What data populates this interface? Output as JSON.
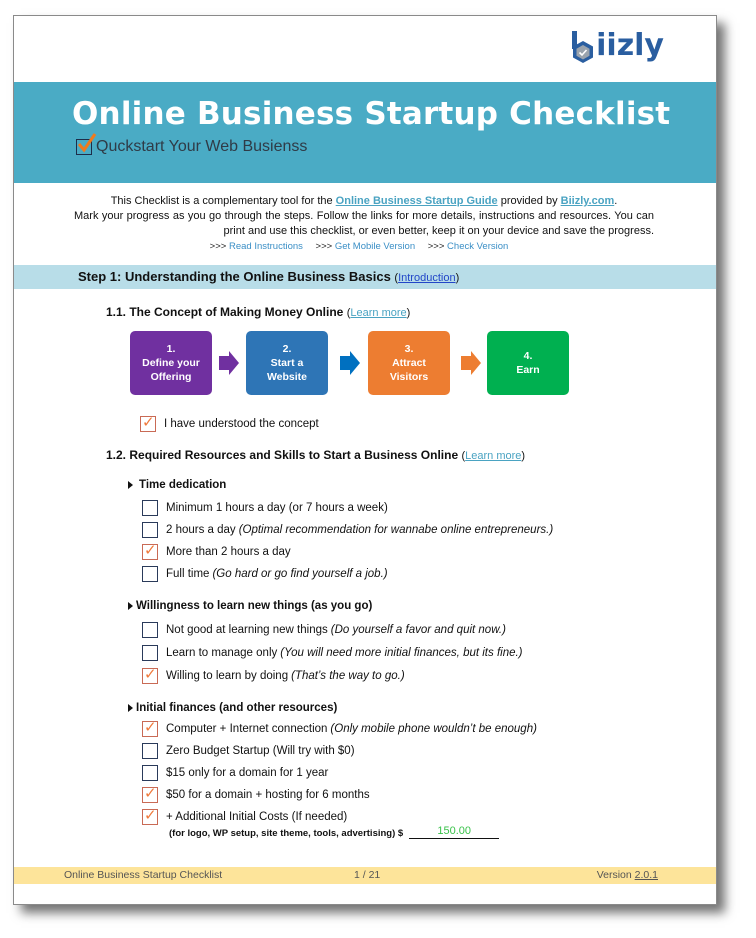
{
  "brand": {
    "logo_text": "iizly",
    "logo_color": "#2a5ea0",
    "banner_color": "#4aabc5"
  },
  "header": {
    "title": "Online Business Startup Checklist",
    "subtitle": "Quckstart Your Web Busienss"
  },
  "intro": {
    "line1_pre": "This Checklist is a complementary tool for the ",
    "guide_link": "Online Business Startup Guide",
    "line1_mid": " provided by ",
    "site_link": "Biizly.com",
    "line1_post": ".",
    "line2": "Mark your progress as you go through the steps. Follow the links for more details, instructions and resources. You can print and use this checklist, or even better, keep it on your device and save the progress.",
    "links": [
      {
        "prefix": ">>> ",
        "label": "Read Instructions"
      },
      {
        "prefix": ">>> ",
        "label": "Get Mobile Version"
      },
      {
        "prefix": ">>> ",
        "label": "Check Version"
      }
    ]
  },
  "step1": {
    "title": "Step 1: Understanding the Online Business Basics ",
    "link": "Introduction",
    "s11": {
      "title": "1.1. The Concept of Making Money Online ",
      "link": "Learn more",
      "flow": [
        {
          "num": "1.",
          "label": "Define your Offering",
          "color": "#7030a0"
        },
        {
          "num": "2.",
          "label": "Start a Website",
          "color": "#2e75b6"
        },
        {
          "num": "3.",
          "label": "Attract Visitors",
          "color": "#ed7d31"
        },
        {
          "num": "4.",
          "label": "Earn",
          "color": "#00b050"
        }
      ],
      "arrow_colors": [
        "#7030a0",
        "#0070c0",
        "#ed7d31"
      ],
      "check": {
        "label": "I have understood the concept",
        "checked": true
      }
    },
    "s12": {
      "title": "1.2. Required Resources and Skills to Start a Business Online ",
      "link": "Learn more",
      "groups": [
        {
          "label": "Time dedication",
          "items": [
            {
              "label": "Minimum 1 hours a day (or 7 hours a week)",
              "note": "",
              "checked": false
            },
            {
              "label": "2 hours a day",
              "note": "(Optimal recommendation for wannabe online entrepreneurs.)",
              "checked": false
            },
            {
              "label": "More than 2 hours a day",
              "note": "",
              "checked": true
            },
            {
              "label": "Full time",
              "note": "(Go hard or go find yourself a job.)",
              "checked": false
            }
          ]
        },
        {
          "label": "Willingness to learn new things (as you go)",
          "items": [
            {
              "label": "Not good at learning new things",
              "note": "(Do yourself a favor and quit now.)",
              "checked": false
            },
            {
              "label": "Learn to manage only",
              "note": "(You will need more initial finances, but its fine.)",
              "checked": false
            },
            {
              "label": "Willing to learn by doing",
              "note": "(That’s the way to go.)",
              "checked": true
            }
          ]
        },
        {
          "label": "Initial finances (and other resources)",
          "items": [
            {
              "label": "Computer + Internet connection",
              "note": "(Only mobile phone wouldn’t be enough)",
              "checked": true
            },
            {
              "label": "Zero Budget Startup (Will try with $0)",
              "note": "",
              "checked": false
            },
            {
              "label": "$15 only for a domain for 1 year",
              "note": "",
              "checked": false
            },
            {
              "label": "$50 for a domain + hosting for 6 months",
              "note": "",
              "checked": true
            },
            {
              "label": "+ Additional Initial Costs (If needed)",
              "note": "",
              "checked": true
            }
          ]
        }
      ],
      "additional_note": "(for logo, WP setup, site theme, tools, advertising) $",
      "additional_amount": "150.00"
    }
  },
  "footer": {
    "title": "Online Business Startup Checklist",
    "page": "1 / 21",
    "version_label": "Version ",
    "version": "2.0.1"
  }
}
